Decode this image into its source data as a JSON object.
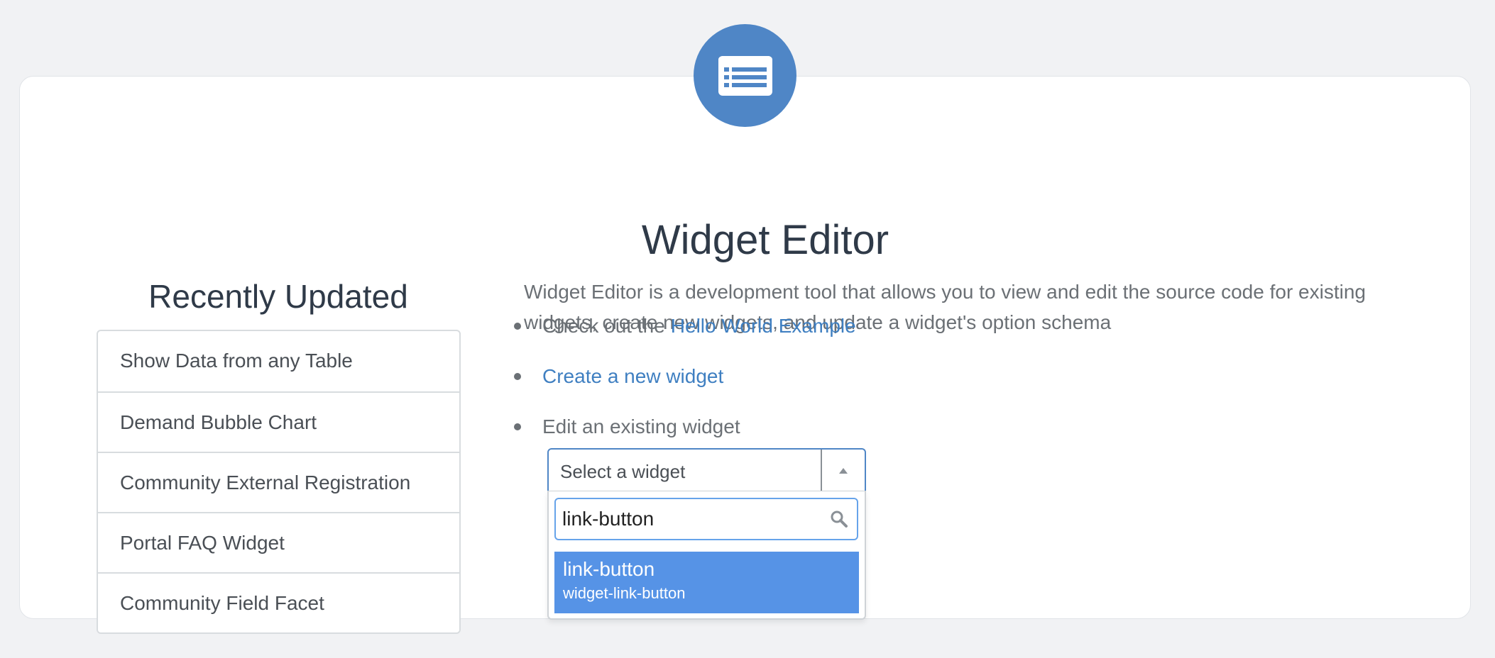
{
  "header": {
    "icon": "list-window-icon",
    "title": "Widget Editor"
  },
  "recently_updated": {
    "title": "Recently Updated",
    "items": [
      "Show Data from any Table",
      "Demand Bubble Chart",
      "Community External Registration",
      "Portal FAQ Widget",
      "Community Field Facet"
    ]
  },
  "main": {
    "description": "Widget Editor is a development tool that allows you to view and edit the source code for existing widgets, create new widgets, and update a widget's option schema",
    "bullets": {
      "check_prefix": "Check out the",
      "hello_link": "Hello World Example",
      "create_link": "Create a new widget",
      "edit_text": "Edit an existing widget"
    }
  },
  "widget_select": {
    "label": "Select a widget",
    "search_value": "link-button",
    "results": [
      {
        "title": "link-button",
        "id": "widget-link-button"
      }
    ]
  },
  "colors": {
    "accent": "#4f86c6",
    "link": "#3f7fc1",
    "highlight": "#5693e6"
  }
}
